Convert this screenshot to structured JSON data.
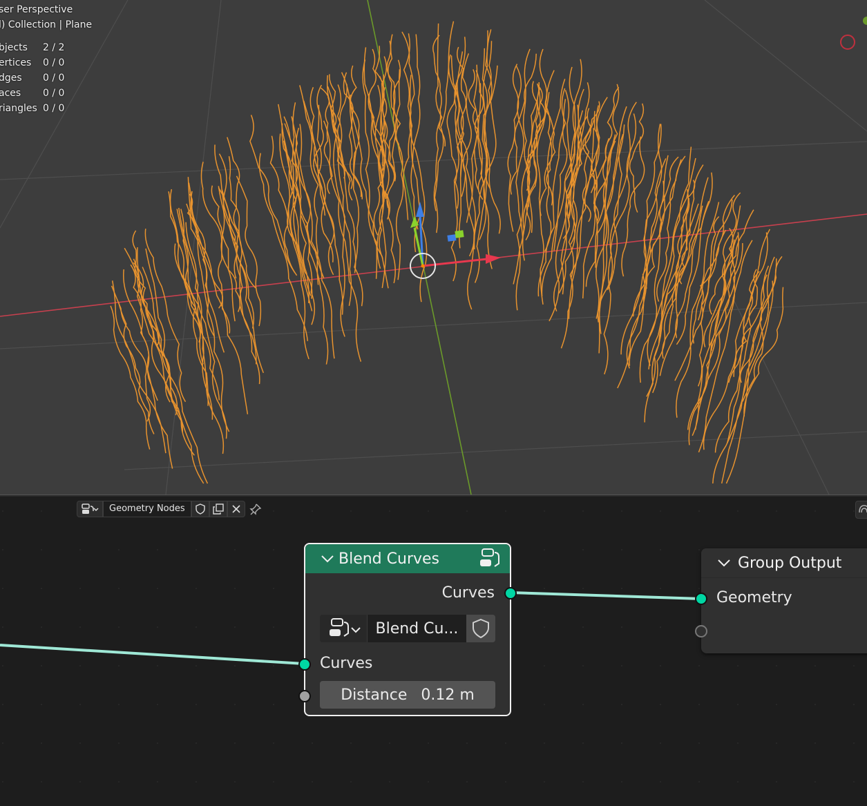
{
  "viewport": {
    "mode": "ser Perspective",
    "collection": "l) Collection | Plane",
    "stats": [
      {
        "label": "bjects",
        "value": "2 / 2"
      },
      {
        "label": "ertices",
        "value": "0 / 0"
      },
      {
        "label": "dges",
        "value": "0 / 0"
      },
      {
        "label": "aces",
        "value": "0 / 0"
      },
      {
        "label": "riangles",
        "value": "0 / 0"
      }
    ],
    "hair_color": "#e8932e",
    "axis_x_color": "#c8404e",
    "axis_y_color": "#6b9a2a"
  },
  "node_editor": {
    "tree_name": "Geometry Nodes",
    "blend_curves": {
      "title": "Blend Curves",
      "output_label": "Curves",
      "group_name": "Blend Cu...",
      "input_label": "Curves",
      "distance_label": "Distance",
      "distance_value": "0.12 m",
      "header_color": "#1f7a5a"
    },
    "group_output": {
      "title": "Group Output",
      "input_label": "Geometry"
    },
    "link_color": "#9fe8d6",
    "geometry_socket_color": "#00d6a3"
  }
}
